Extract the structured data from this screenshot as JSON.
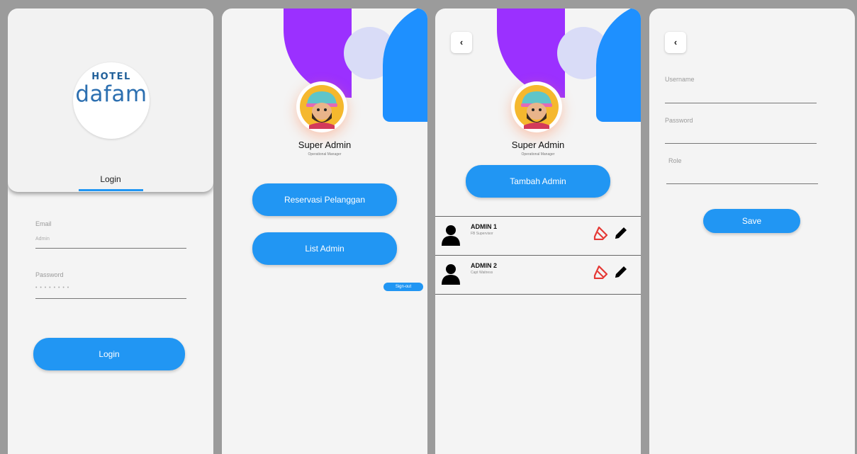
{
  "login_screen": {
    "logo_top": "HOTEL",
    "logo_main": "dafam",
    "tab_label": "Login",
    "email_label": "Email",
    "email_value": "Admin",
    "password_label": "Password",
    "password_value": "• • • • • • • •",
    "login_button": "Login"
  },
  "dashboard_screen": {
    "user_name": "Super Admin",
    "user_role": "Operational Manager",
    "menu": [
      "Reservasi Pelanggan",
      "List Admin"
    ],
    "signout_label": "Sign-out"
  },
  "admin_list_screen": {
    "back_icon": "chevron-left-icon",
    "user_name": "Super Admin",
    "user_role": "Operational Manager",
    "add_button": "Tambah Admin",
    "admins": [
      {
        "name": "ADMIN 1",
        "role": "FB Supervisor"
      },
      {
        "name": "ADMIN 2",
        "role": "Capt Waitress"
      }
    ]
  },
  "form_screen": {
    "back_icon": "chevron-left-icon",
    "username_label": "Username",
    "password_label": "Password",
    "role_label": "Role",
    "save_button": "Save"
  },
  "colors": {
    "accent": "#2196f3",
    "purple": "#9b30ff",
    "delete": "#e53935"
  }
}
